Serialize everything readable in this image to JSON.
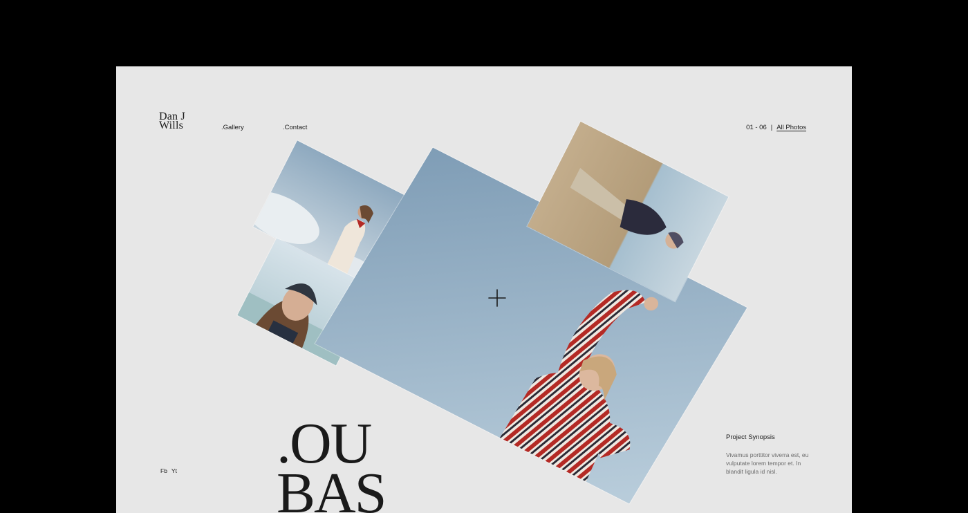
{
  "brand": {
    "line1": "Dan J",
    "line2": "Wills"
  },
  "nav": {
    "gallery": ".Gallery",
    "contact": ".Contact"
  },
  "counter": {
    "range": "01 - 06",
    "separator": "|",
    "all_photos": "All Photos"
  },
  "social": {
    "fb": "Fb",
    "yt": "Yt"
  },
  "hero": {
    "line1": ".OU",
    "line2": "BAS"
  },
  "synopsis": {
    "title": "Project Synopsis",
    "body": "Vivamus porttitor viverra est, eu vulputate lorem tempor et. In blandit ligula id nisl."
  },
  "colors": {
    "background": "#000000",
    "canvas": "#e7e7e7",
    "text": "#1a1a1a",
    "muted": "#6b6b6b",
    "sky": "#9fb8cc",
    "stripe_red": "#b42a25"
  },
  "icons": {
    "cursor": "crosshair-icon"
  }
}
